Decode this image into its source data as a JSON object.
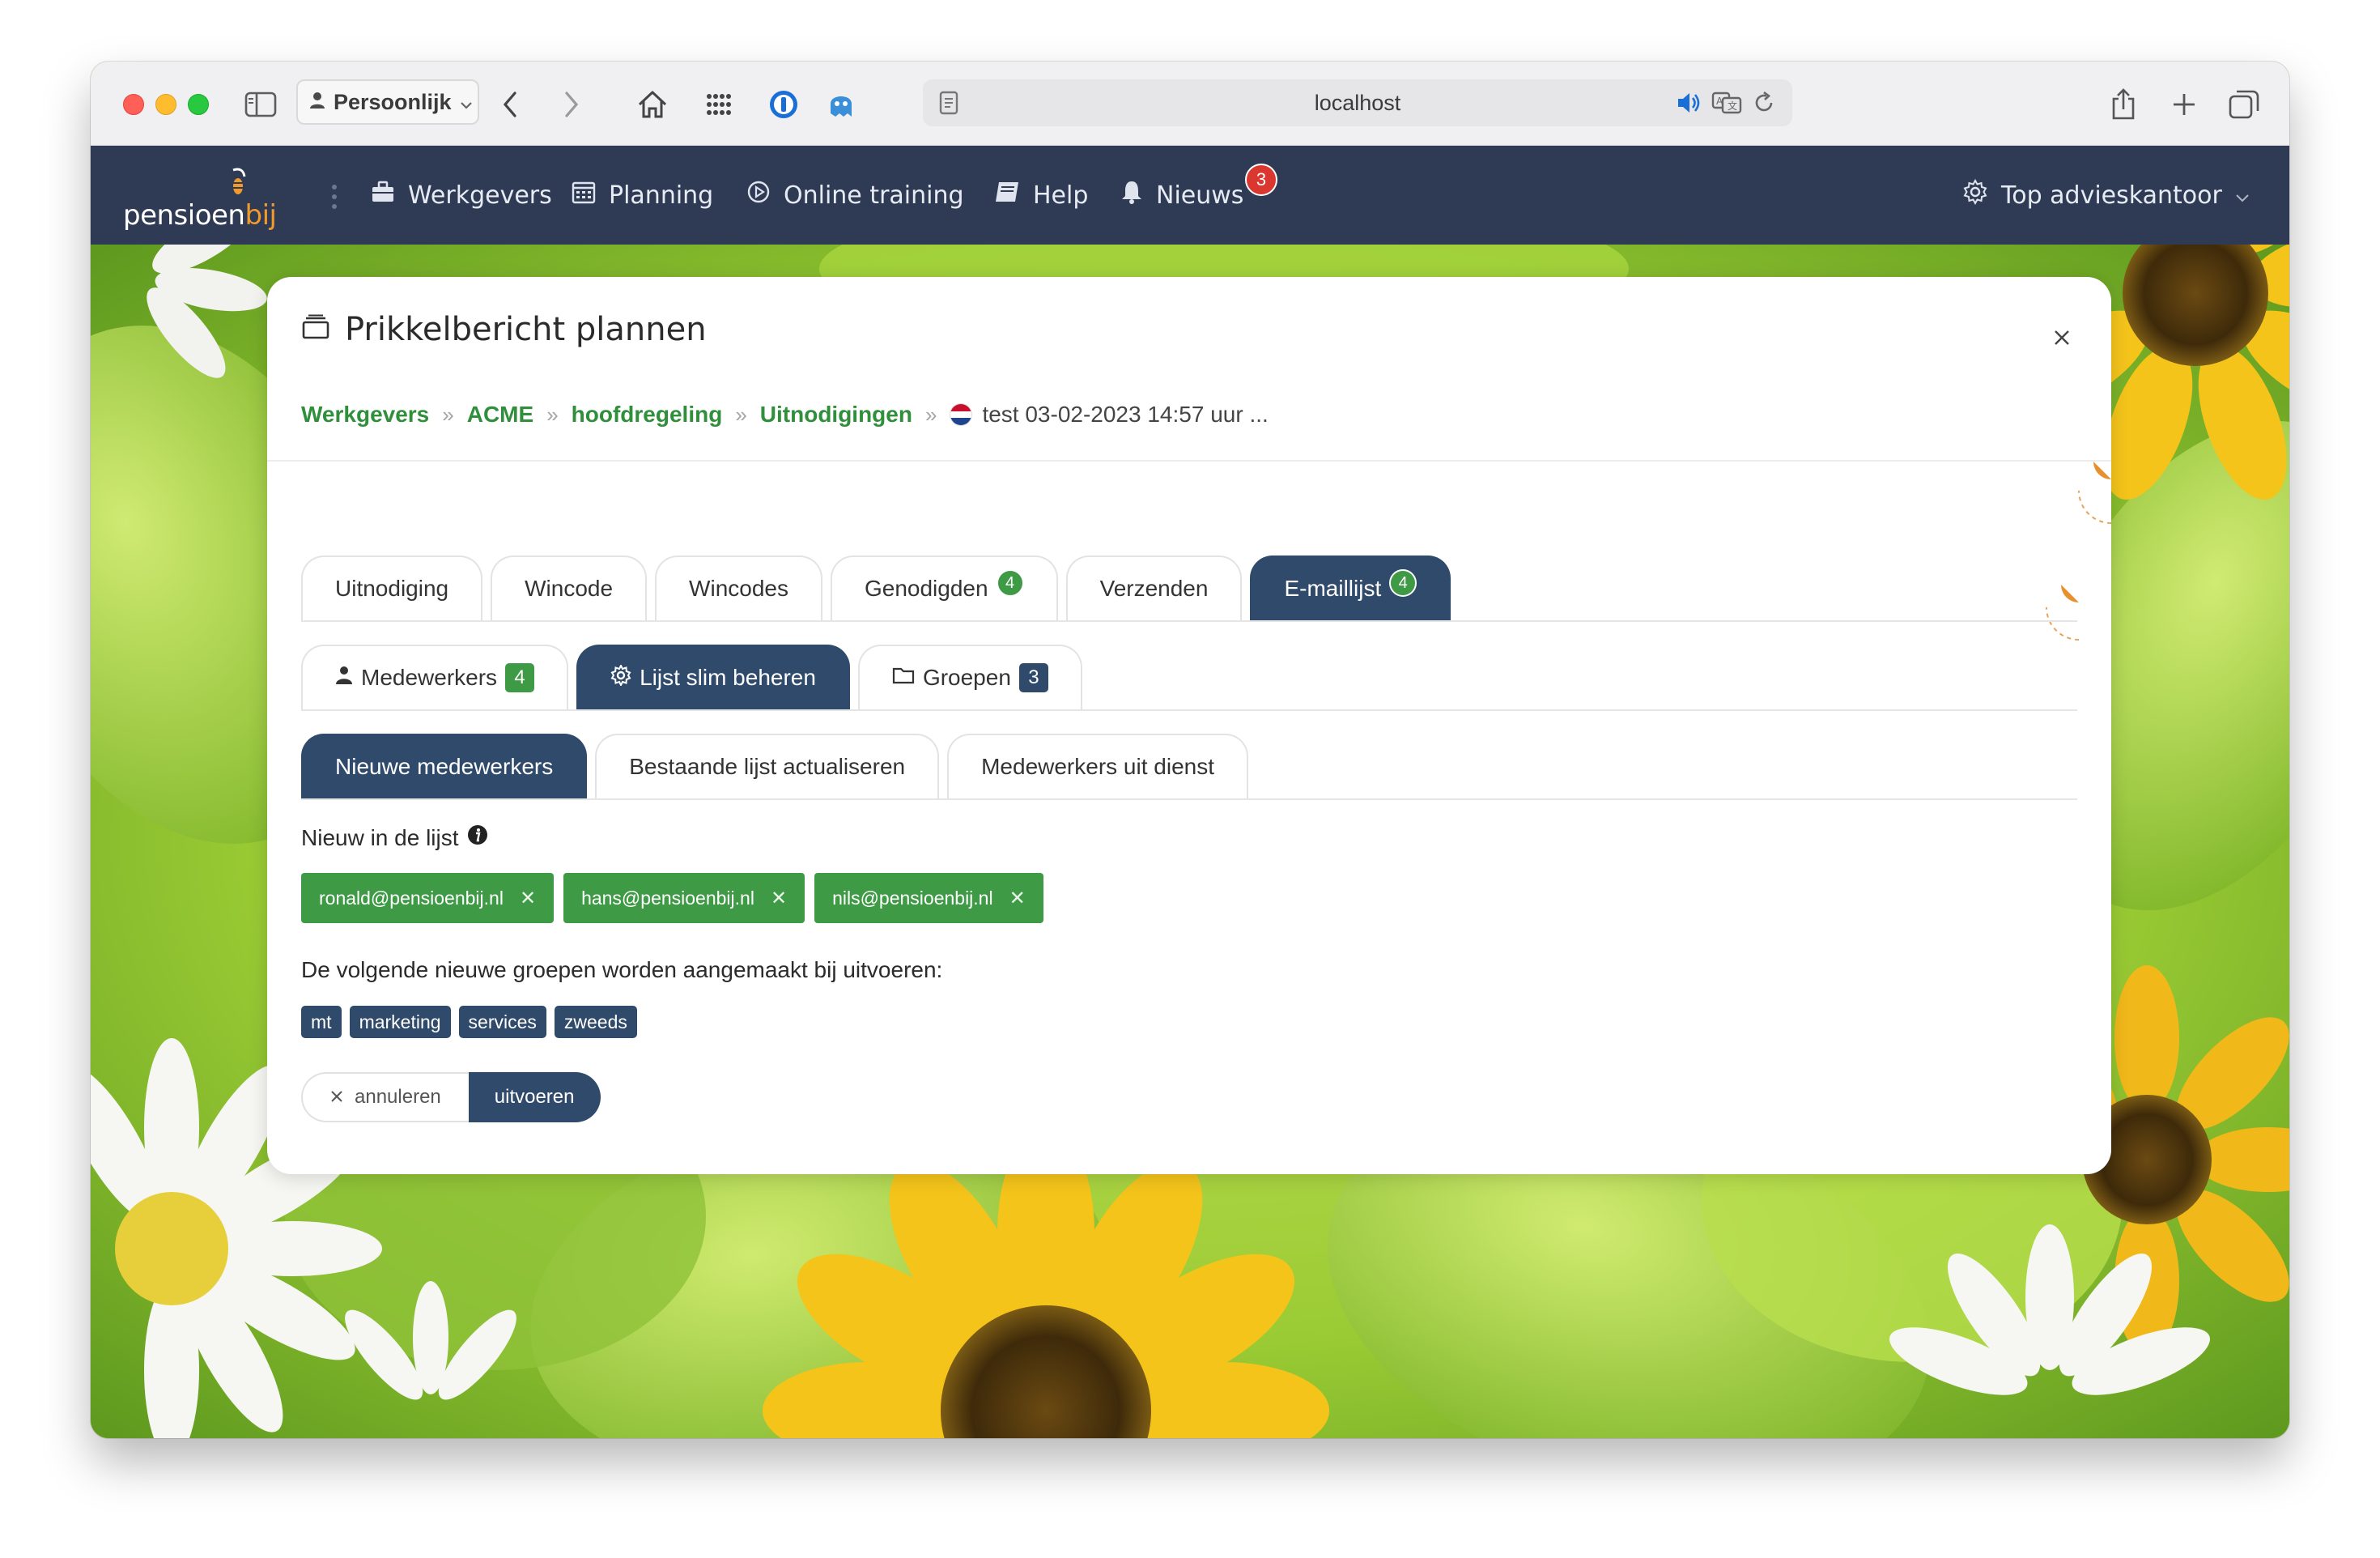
{
  "browser": {
    "profile_label": "Persoonlijk",
    "url": "localhost"
  },
  "app": {
    "logo_text_main": "pensioen",
    "logo_text_accent": "bij",
    "nav": [
      {
        "label": "Werkgevers",
        "icon": "briefcase-icon"
      },
      {
        "label": "Planning",
        "icon": "calendar-icon"
      },
      {
        "label": "Online training",
        "icon": "play-circle-icon"
      },
      {
        "label": "Help",
        "icon": "book-icon"
      },
      {
        "label": "Nieuws",
        "icon": "bell-icon",
        "badge": "3"
      }
    ],
    "account_label": "Top advieskantoor"
  },
  "modal": {
    "title": "Prikkelbericht plannen",
    "breadcrumb": {
      "items": [
        "Werkgevers",
        "ACME",
        "hoofdregeling",
        "Uitnodigingen"
      ],
      "current": "test 03-02-2023 14:57 uur ..."
    },
    "tabs": [
      {
        "label": "Uitnodiging"
      },
      {
        "label": "Wincode"
      },
      {
        "label": "Wincodes"
      },
      {
        "label": "Genodigden",
        "badge": "4"
      },
      {
        "label": "Verzenden"
      },
      {
        "label": "E-maillijst",
        "badge": "4",
        "active": true
      }
    ],
    "subtabs": [
      {
        "label": "Medewerkers",
        "badge": "4"
      },
      {
        "label": "Lijst slim beheren",
        "active": true
      },
      {
        "label": "Groepen",
        "badge": "3"
      }
    ],
    "subsubtabs": [
      {
        "label": "Nieuwe medewerkers",
        "active": true
      },
      {
        "label": "Bestaande lijst actualiseren"
      },
      {
        "label": "Medewerkers uit dienst"
      }
    ],
    "new_in_list_label": "Nieuw in de lijst",
    "emails": [
      "ronald@pensioenbij.nl",
      "hans@pensioenbij.nl",
      "nils@pensioenbij.nl"
    ],
    "groups_label": "De volgende nieuwe groepen worden aangemaakt bij uitvoeren:",
    "groups": [
      "mt",
      "marketing",
      "services",
      "zweeds"
    ],
    "cancel_label": "annuleren",
    "execute_label": "uitvoeren"
  },
  "colors": {
    "header_bg": "#2f3b55",
    "active_tab": "#2f4a6b",
    "link_green": "#2f8f3a",
    "chip_green": "#3e9a45",
    "badge_red": "#d9372f",
    "logo_orange": "#f09a2e"
  }
}
